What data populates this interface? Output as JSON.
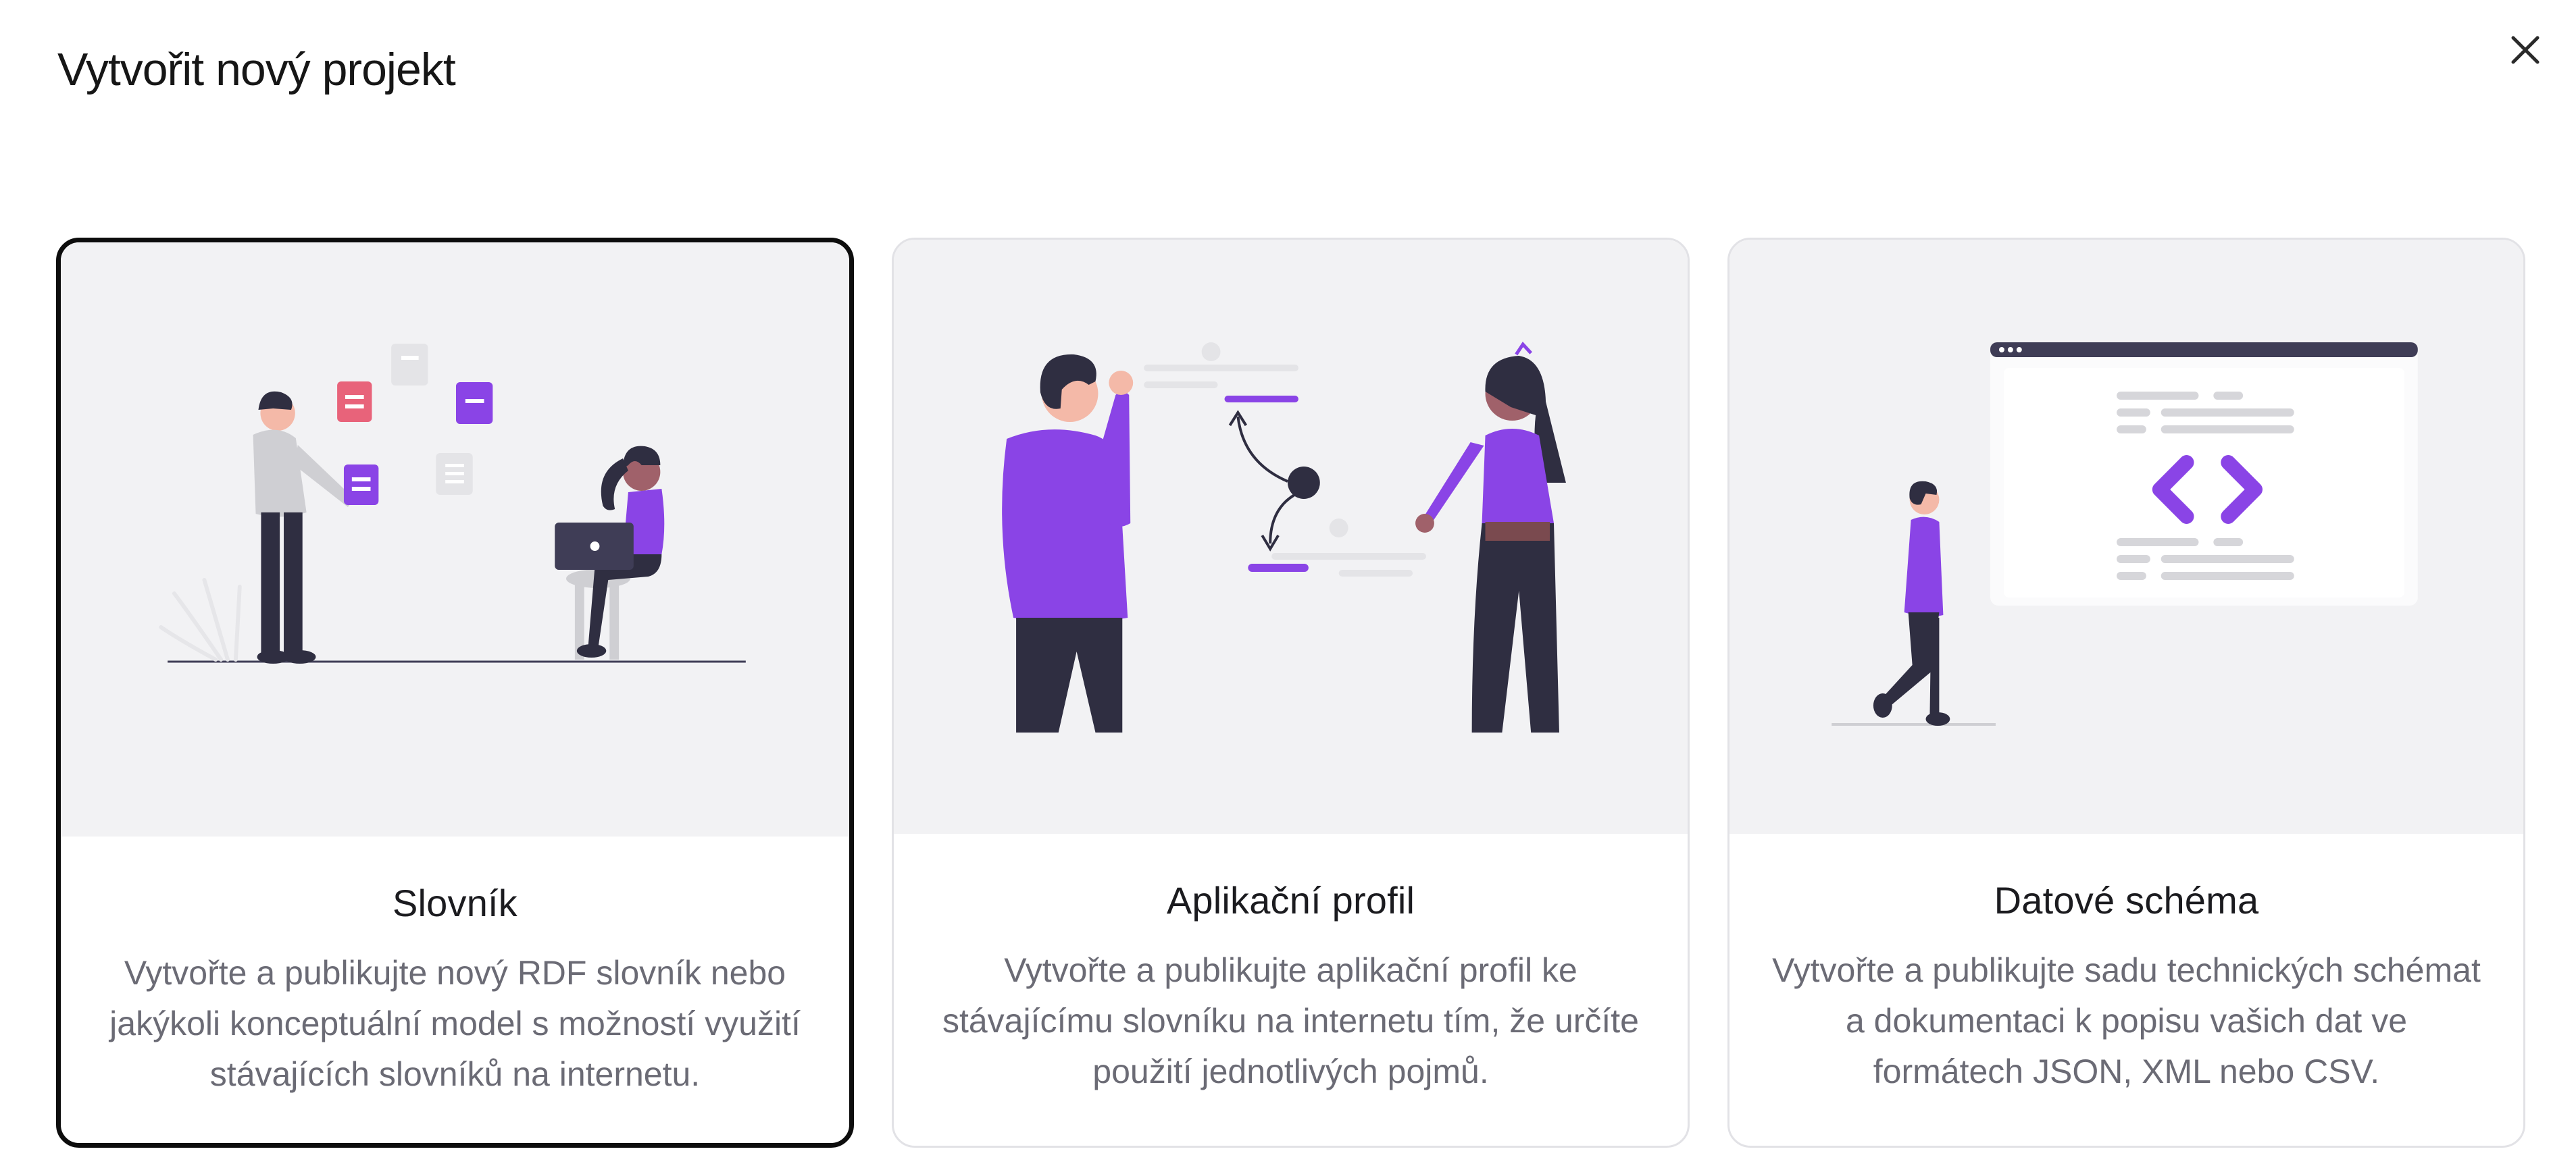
{
  "dialog": {
    "title": "Vytvořit nový projekt",
    "close_icon": "close-icon"
  },
  "cards": [
    {
      "title": "Slovník",
      "description": "Vytvořte a publikujte nový RDF slovník nebo jakýkoli konceptuální model s možností využití stávajících slovníků na internetu.",
      "selected": true,
      "illustration": "people-collaborating-illustration"
    },
    {
      "title": "Aplikační profil",
      "description": "Vytvořte a publikujte aplikační profil ke stávajícímu slovníku na internetu tím, že určíte použití jednotlivých pojmů.",
      "selected": false,
      "illustration": "people-linking-concepts-illustration"
    },
    {
      "title": "Datové schéma",
      "description": "Vytvořte a publikujte sadu technických schémat a dokumentaci k popisu vašich dat ve formátech JSON, XML nebo CSV.",
      "selected": false,
      "illustration": "code-window-illustration"
    }
  ],
  "colors": {
    "accent": "#8a44e6",
    "dark": "#2f2e41",
    "pink": "#e8637a",
    "illustration_bg": "#f2f2f4",
    "selected_border": "#0d0d0d"
  }
}
